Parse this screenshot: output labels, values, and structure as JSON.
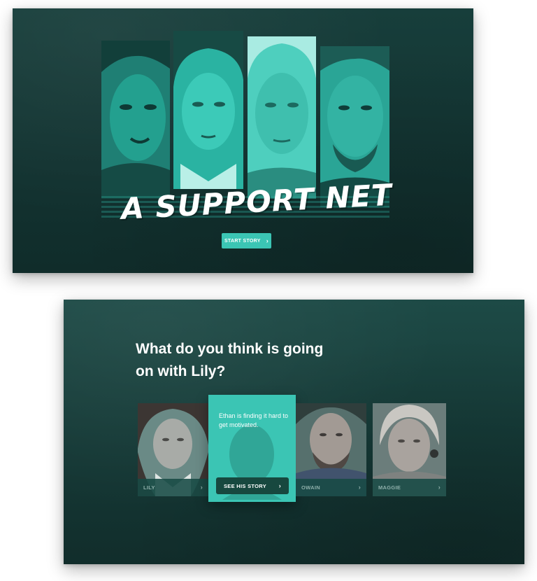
{
  "hero": {
    "title": "A SUPPORT NET",
    "start_button": "START STORY",
    "chevron": "›"
  },
  "question": {
    "line1": "What do you think is going",
    "line2": "on with Lily?"
  },
  "cards": {
    "lily": {
      "label": "LILY"
    },
    "active": {
      "text": "Ethan is finding it hard to get motivated.",
      "button": "SEE HIS STORY"
    },
    "owain": {
      "label": "OWAIN"
    },
    "maggie": {
      "label": "MAGGIE"
    }
  },
  "colors": {
    "accent": "#3bc5b4",
    "panel_dark": "#133432",
    "button_dark": "#17483f"
  },
  "icons": {
    "chevron": "chevron-right-icon"
  }
}
